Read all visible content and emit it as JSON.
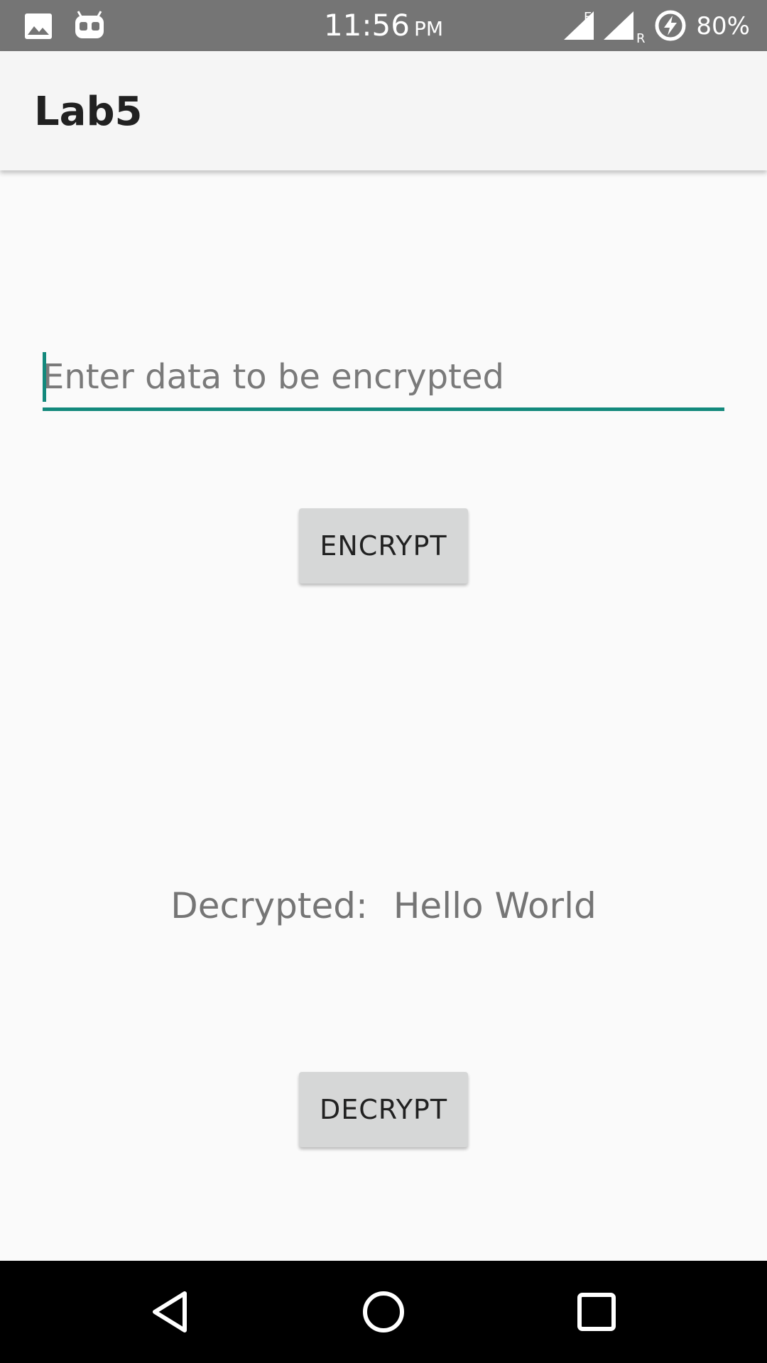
{
  "status_bar": {
    "time": "11:56",
    "ampm": "PM",
    "network_type": "E",
    "roaming": "R",
    "battery": "80%",
    "icons": [
      "image-icon",
      "android-debug-icon",
      "signal-icon",
      "signal-roaming-icon",
      "battery-charging-icon"
    ]
  },
  "app_bar": {
    "title": "Lab5"
  },
  "input": {
    "placeholder": "Enter data to be encrypted",
    "value": ""
  },
  "buttons": {
    "encrypt": "ENCRYPT",
    "decrypt": "DECRYPT"
  },
  "decrypted": {
    "label": "Decrypted:",
    "value": "Hello World"
  },
  "nav_bar": {
    "icons": [
      "back-icon",
      "home-icon",
      "recents-icon"
    ]
  },
  "colors": {
    "status_bar": "#757575",
    "app_bar": "#f5f5f5",
    "accent": "#13897c",
    "button": "#d6d7d7",
    "background": "#fafafa",
    "nav_bar": "#000000"
  }
}
